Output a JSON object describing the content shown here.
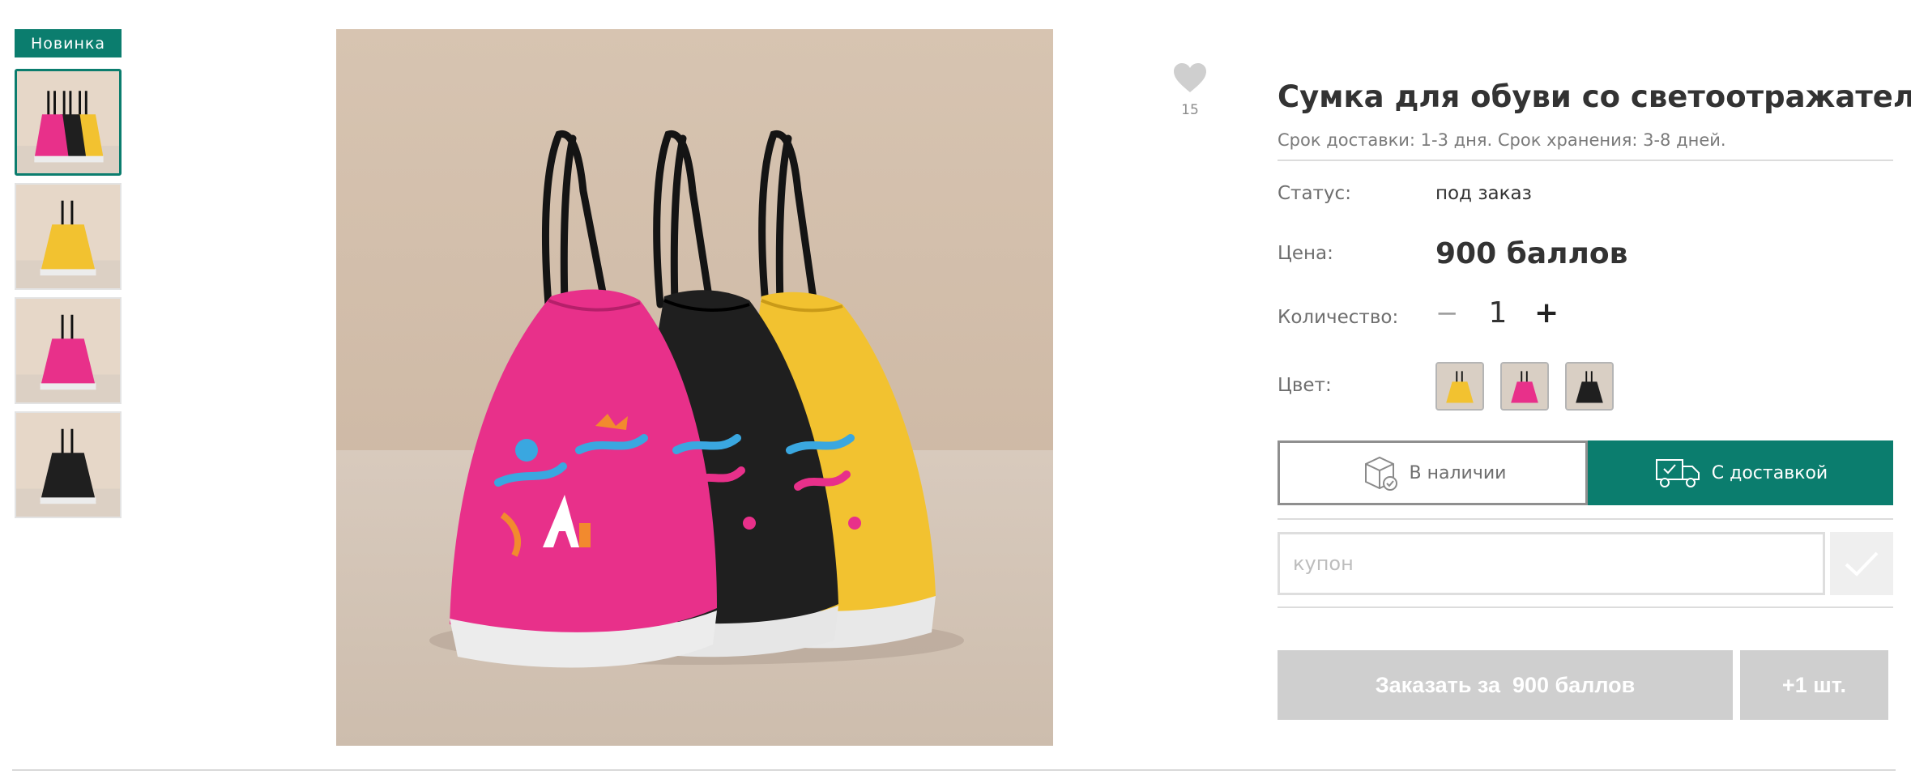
{
  "badge": {
    "label": "Новинка"
  },
  "gallery": {
    "thumbnails": [
      {
        "colors": [
          "#e8308a",
          "#1f1f1f",
          "#f2c230"
        ]
      },
      {
        "colors": [
          "#f2c230"
        ]
      },
      {
        "colors": [
          "#e8308a"
        ]
      },
      {
        "colors": [
          "#1f1f1f"
        ]
      }
    ],
    "selected_index": 0
  },
  "favorite": {
    "icon": "heart-icon",
    "count": "15"
  },
  "product": {
    "title": "Сумка для обуви со светоотражателем",
    "subtitle": "Срок доставки: 1-3 дня. Срок хранения: 3-8 дней.",
    "status_label": "Статус:",
    "status_value": "под заказ",
    "price_label": "Цена:",
    "price_value": "900 баллов",
    "quantity_label": "Количество:",
    "quantity_minus": "−",
    "quantity_value": "1",
    "quantity_plus": "+",
    "color_label": "Цвет:",
    "color_options": [
      "#f2c230",
      "#e8308a",
      "#1f1f1f"
    ]
  },
  "delivery": {
    "pickup_label": "В наличии",
    "pickup_icon": "box-check-icon",
    "shipping_label": "С доставкой",
    "shipping_icon": "truck-icon",
    "selected": "shipping"
  },
  "coupon": {
    "placeholder": "купон",
    "value": "",
    "apply_icon": "check-icon"
  },
  "actions": {
    "order_label": "Заказать за  900 баллов",
    "plus_one_label": "+1 шт."
  },
  "theme": {
    "accent": "#0b7d6e",
    "disabled": "#cfcfcf"
  }
}
